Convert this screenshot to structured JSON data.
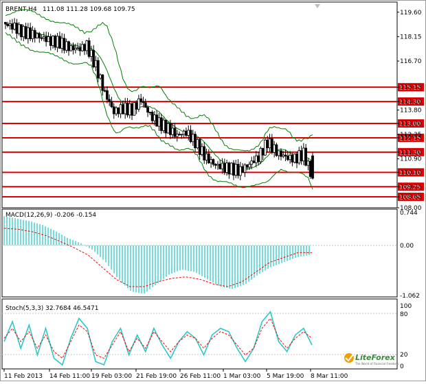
{
  "window": {
    "title": "BRENT,H4",
    "ohlc": "111.08 111.28 109.68 109.75",
    "restore_icon": "restore-icon"
  },
  "price_panel": {
    "price_labels": [
      "119.60",
      "118.15",
      "116.70",
      "115.15",
      "114.30",
      "113.80",
      "113.00",
      "112.35",
      "112.15",
      "111.30",
      "110.90",
      "110.10",
      "109.25",
      "108.65",
      "108.00"
    ],
    "level_labels": [
      "115.15",
      "114.30",
      "113.00",
      "112.15",
      "111.30",
      "110.10",
      "109.25",
      "108.65"
    ],
    "level_color": "#dd0000",
    "candle_color": "#000000",
    "band_color": "#008000"
  },
  "macd_panel": {
    "title": "MACD(12,26,9) -0.206 -0.154",
    "axis_labels": [
      "0.744",
      "0.00",
      "-1.062"
    ],
    "hist_color": "#2bc8c8",
    "signal_color": "#ff0000"
  },
  "stoch_panel": {
    "title": "Stoch(5,3,3) 32.7684 46.5471",
    "axis_labels": [
      "100",
      "80",
      "20",
      "0"
    ],
    "main_color": "#2bc8c8",
    "signal_color": "#ff0000"
  },
  "time_axis": {
    "labels": [
      "11 Feb 2013",
      "14 Feb 11:00",
      "19 Feb 03:00",
      "21 Feb 19:00",
      "26 Feb 11:00",
      "1 Mar 03:00",
      "5 Mar 19:00",
      "8 Mar 11:00"
    ]
  },
  "logo": {
    "name": "LiteForex",
    "tagline": "The World of Financial Freedom"
  },
  "chart_data": [
    {
      "type": "candlestick",
      "title": "BRENT,H4",
      "ohlc_last": [
        111.08,
        111.28,
        109.68,
        109.75
      ],
      "ylim": [
        108.0,
        120.2
      ],
      "horizontal_levels": [
        115.15,
        114.3,
        113.0,
        112.15,
        111.3,
        110.1,
        109.25,
        108.65
      ],
      "x": [
        "11 Feb 2013",
        "14 Feb 11:00",
        "19 Feb 03:00",
        "21 Feb 19:00",
        "26 Feb 11:00",
        "1 Mar 03:00",
        "5 Mar 19:00",
        "8 Mar 11:00"
      ],
      "close_path": [
        118.9,
        118.7,
        118.4,
        118.3,
        118.1,
        117.9,
        117.8,
        117.5,
        117.4,
        117.6,
        116.4,
        114.8,
        113.7,
        113.9,
        113.8,
        114.4,
        113.5,
        113.0,
        112.7,
        112.3,
        112.5,
        111.9,
        111.1,
        110.6,
        110.4,
        110.3,
        110.2,
        110.6,
        111.0,
        111.9,
        111.3,
        111.0,
        110.9,
        111.2,
        109.75
      ]
    },
    {
      "type": "histogram+line",
      "title": "MACD(12,26,9)",
      "values_last": [
        -0.206,
        -0.154
      ],
      "ylim": [
        -1.062,
        0.744
      ],
      "hist": [
        0.6,
        0.55,
        0.5,
        0.42,
        0.3,
        0.15,
        0.05,
        -0.1,
        -0.35,
        -0.7,
        -0.95,
        -1.0,
        -0.8,
        -0.6,
        -0.5,
        -0.55,
        -0.7,
        -0.85,
        -0.9,
        -0.8,
        -0.6,
        -0.45,
        -0.35,
        -0.25,
        -0.2
      ],
      "signal": [
        0.35,
        0.33,
        0.28,
        0.2,
        0.08,
        -0.05,
        -0.2,
        -0.45,
        -0.7,
        -0.85,
        -0.85,
        -0.75,
        -0.68,
        -0.65,
        -0.7,
        -0.8,
        -0.85,
        -0.75,
        -0.55,
        -0.35,
        -0.25,
        -0.15,
        -0.15
      ]
    },
    {
      "type": "line",
      "title": "Stoch(5,3,3)",
      "values_last": [
        32.7684,
        46.5471
      ],
      "ylim": [
        0,
        100
      ],
      "main": [
        40,
        70,
        30,
        65,
        20,
        60,
        15,
        5,
        45,
        75,
        60,
        10,
        5,
        40,
        60,
        20,
        50,
        25,
        60,
        35,
        15,
        40,
        55,
        45,
        20,
        50,
        60,
        55,
        30,
        10,
        30,
        70,
        85,
        40,
        25,
        50,
        60,
        35
      ],
      "signal": [
        45,
        60,
        40,
        55,
        30,
        50,
        25,
        15,
        40,
        65,
        55,
        20,
        15,
        35,
        55,
        25,
        45,
        30,
        55,
        40,
        25,
        40,
        50,
        45,
        30,
        45,
        55,
        50,
        35,
        20,
        30,
        60,
        75,
        45,
        30,
        45,
        55,
        45
      ]
    }
  ]
}
